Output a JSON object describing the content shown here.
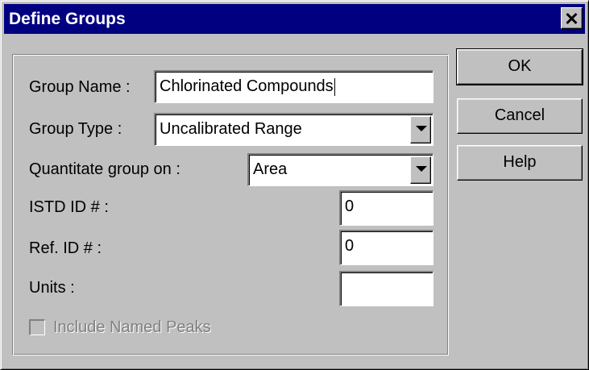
{
  "window": {
    "title": "Define Groups",
    "close_glyph": "✕"
  },
  "form": {
    "group_name_label": "Group Name :",
    "group_name_value": "Chlorinated Compounds",
    "group_type_label": "Group Type :",
    "group_type_value": "Uncalibrated Range",
    "quantitate_label": "Quantitate group on :",
    "quantitate_value": "Area",
    "istd_label": "ISTD ID # :",
    "istd_value": "0",
    "ref_label": "Ref. ID # :",
    "ref_value": "0",
    "units_label": "Units :",
    "units_value": "",
    "include_named_peaks_label": "Include Named Peaks",
    "include_named_peaks_checked": false,
    "include_named_peaks_enabled": false
  },
  "buttons": {
    "ok": "OK",
    "cancel": "Cancel",
    "help": "Help"
  },
  "colors": {
    "titlebar": "#000080",
    "face": "#c0c0c0"
  }
}
